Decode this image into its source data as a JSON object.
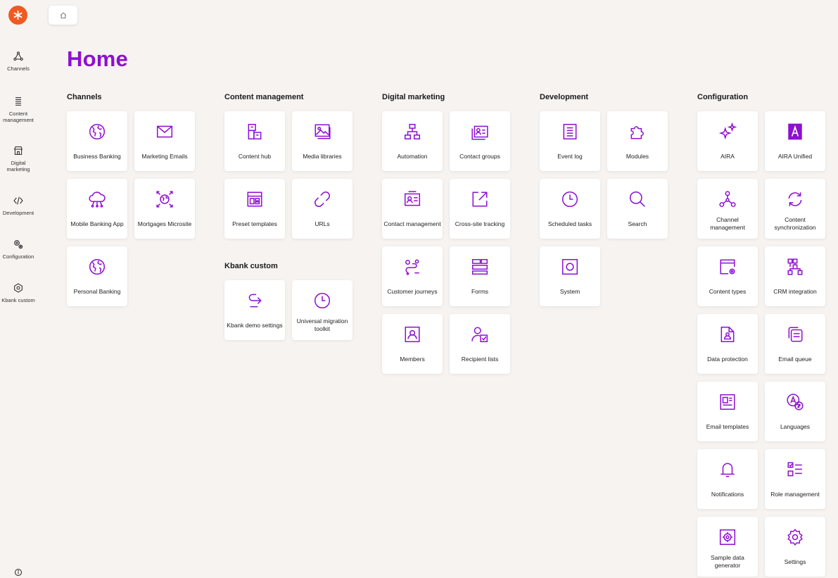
{
  "colors": {
    "accent": "#8e10d0",
    "logo": "#f05a22",
    "background": "#f6f3f1"
  },
  "page": {
    "title": "Home"
  },
  "sidebar": {
    "items": [
      {
        "label": "Channels",
        "icon": "channels-icon"
      },
      {
        "label": "Content management",
        "icon": "content-management-icon"
      },
      {
        "label": "Digital marketing",
        "icon": "digital-marketing-icon"
      },
      {
        "label": "Development",
        "icon": "development-icon"
      },
      {
        "label": "Configuration",
        "icon": "configuration-icon"
      },
      {
        "label": "Kbank custom",
        "icon": "kbank-custom-icon"
      }
    ]
  },
  "sections": {
    "channels": {
      "title": "Channels",
      "tiles": [
        {
          "label": "Business Banking",
          "icon": "globe-icon"
        },
        {
          "label": "Marketing Emails",
          "icon": "envelope-icon"
        },
        {
          "label": "Mobile Banking App",
          "icon": "cloud-network-icon"
        },
        {
          "label": "Mortgages Microsite",
          "icon": "globe-arrows-icon"
        },
        {
          "label": "Personal Banking",
          "icon": "globe-icon"
        }
      ]
    },
    "content_management": {
      "title": "Content management",
      "tiles": [
        {
          "label": "Content hub",
          "icon": "content-hub-icon"
        },
        {
          "label": "Media libraries",
          "icon": "media-library-icon"
        },
        {
          "label": "Preset templates",
          "icon": "layout-template-icon"
        },
        {
          "label": "URLs",
          "icon": "link-icon"
        }
      ]
    },
    "kbank_custom": {
      "title": "Kbank custom",
      "tiles": [
        {
          "label": "Kbank demo settings",
          "icon": "redirect-arrow-icon"
        },
        {
          "label": "Universal migration toolkit",
          "icon": "clock-icon"
        }
      ]
    },
    "digital_marketing": {
      "title": "Digital marketing",
      "tiles": [
        {
          "label": "Automation",
          "icon": "flowchart-icon"
        },
        {
          "label": "Contact groups",
          "icon": "contact-groups-icon"
        },
        {
          "label": "Contact management",
          "icon": "contact-card-icon"
        },
        {
          "label": "Cross-site tracking",
          "icon": "external-link-icon"
        },
        {
          "label": "Customer journeys",
          "icon": "journey-icon"
        },
        {
          "label": "Forms",
          "icon": "form-icon"
        },
        {
          "label": "Members",
          "icon": "member-icon"
        },
        {
          "label": "Recipient lists",
          "icon": "recipient-list-icon"
        }
      ]
    },
    "development": {
      "title": "Development",
      "tiles": [
        {
          "label": "Event log",
          "icon": "document-list-icon"
        },
        {
          "label": "Modules",
          "icon": "puzzle-icon"
        },
        {
          "label": "Scheduled tasks",
          "icon": "clock-icon"
        },
        {
          "label": "Search",
          "icon": "search-icon"
        },
        {
          "label": "System",
          "icon": "system-icon"
        }
      ]
    },
    "configuration": {
      "title": "Configuration",
      "tiles": [
        {
          "label": "AIRA",
          "icon": "sparkles-icon"
        },
        {
          "label": "AIRA Unified",
          "icon": "aira-unified-icon"
        },
        {
          "label": "Channel management",
          "icon": "channels-icon"
        },
        {
          "label": "Content synchronization",
          "icon": "sync-icon"
        },
        {
          "label": "Content types",
          "icon": "content-types-icon"
        },
        {
          "label": "CRM integration",
          "icon": "crm-integration-icon"
        },
        {
          "label": "Data protection",
          "icon": "data-protection-icon"
        },
        {
          "label": "Email queue",
          "icon": "email-queue-icon"
        },
        {
          "label": "Email templates",
          "icon": "email-template-icon"
        },
        {
          "label": "Languages",
          "icon": "languages-icon"
        },
        {
          "label": "Notifications",
          "icon": "bell-icon"
        },
        {
          "label": "Role management",
          "icon": "checklist-icon"
        },
        {
          "label": "Sample data generator",
          "icon": "gear-box-icon"
        },
        {
          "label": "Settings",
          "icon": "gear-icon"
        }
      ]
    }
  }
}
